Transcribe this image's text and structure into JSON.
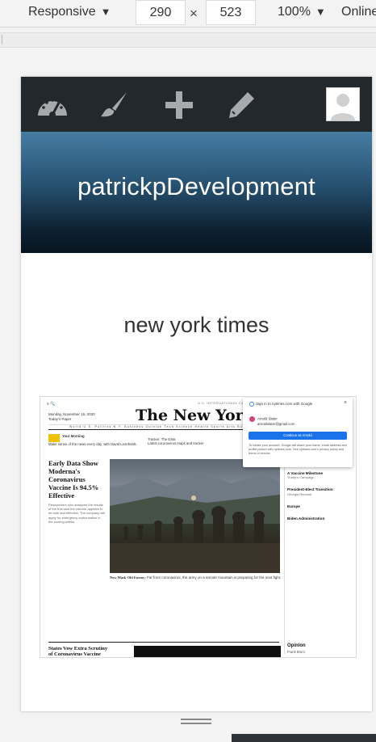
{
  "devtools": {
    "device_mode": "Responsive",
    "width": "290",
    "height": "523",
    "zoom": "100%",
    "throttle": "Online"
  },
  "admin_bar": {
    "icons": [
      "dashboard-icon",
      "customize-brush-icon",
      "new-content-plus-icon",
      "edit-pencil-icon"
    ],
    "avatar": "user-avatar"
  },
  "site": {
    "title": "patrickpDevelopment"
  },
  "post": {
    "title": "new york times"
  },
  "embedded_screenshot": {
    "top_bar": "≡  🔍",
    "sections": "U.S.   INTERNATIONAL   CANADA   ESPAÑOL   中文",
    "date": "Monday, November 16, 2020",
    "date_sub": "Today's Paper",
    "logo": "The New York Times",
    "nav": "World   U.S.   Politics   N.Y.   Business   Opinion   Tech   Science   Health   Sports   Arts   Books   Style   Food   Travel",
    "briefing_title": "Your Morning",
    "briefing_text": "Make sense of the news every day, with David Leonhardt.",
    "tracker_title": "Tracker: The Data",
    "tracker_text": "Latest coronavirus maps and tracker",
    "headline": "Early Data Show Moderna's Coronavirus Vaccine Is 94.5% Effective",
    "lede": "Researchers who analyzed the results of the trial said the vaccine appears to be safe and effective. The company will apply for emergency authorization in the coming weeks.",
    "caption_bold": "New Mask Old Enemy:",
    "caption": "Far from coronavirus, the army on a remote mountain is preparing for the next fight.",
    "side_items": [
      "A Vaccine Milestone",
      "Trump's Campaign",
      "President-Elect Transition",
      "Georgia Recount",
      "Europe",
      "Biden Administration"
    ],
    "bottom_headline": "States Vow Extra Scrutiny of Coronavirus Vaccine",
    "opinion": "Opinion",
    "opinion_sub": "Frank Bruni",
    "popup_title": "Sign in to nytimes.com with Google",
    "popup_account_name": "Arnold Slater",
    "popup_account_email": "arnoldslater@gmail.com",
    "popup_button": "Continue as Arnold",
    "popup_note": "To create your account, Google will share your name, email address and profile picture with nytimes.com. See nytimes.com's privacy policy and terms of service."
  }
}
